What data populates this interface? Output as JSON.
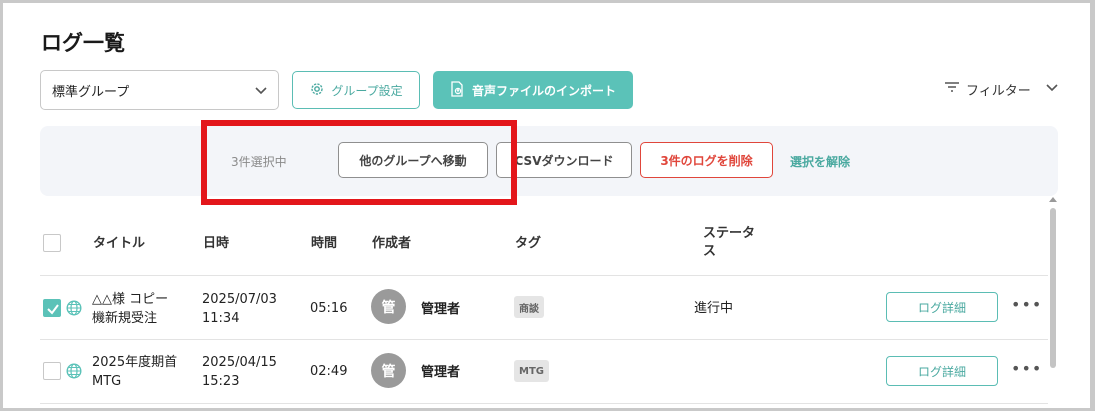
{
  "page": {
    "title": "ログ一覧"
  },
  "toolbar": {
    "group_select_value": "標準グループ",
    "group_settings_label": "グループ設定",
    "import_label": "音声ファイルのインポート",
    "filter_label": "フィルター"
  },
  "selection_bar": {
    "count_text": "3件選択中",
    "move_label": "他のグループへ移動",
    "csv_label": "CSVダウンロード",
    "delete_label": "3件のログを削除",
    "clear_label": "選択を解除"
  },
  "table": {
    "headers": {
      "title": "タイトル",
      "datetime": "日時",
      "duration": "時間",
      "author": "作成者",
      "tag": "タグ",
      "status_line1": "ステータ",
      "status_line2": "ス"
    },
    "rows": [
      {
        "checked": true,
        "title_line1": "△△様 コピー",
        "title_line2": "機新規受注",
        "date": "2025/07/03",
        "time": "11:34",
        "duration": "05:16",
        "avatar": "管",
        "author": "管理者",
        "tag": "商談",
        "status": "進行中",
        "detail_label": "ログ詳細",
        "more": "•••"
      },
      {
        "checked": false,
        "title_line1": "2025年度期首",
        "title_line2": "MTG",
        "date": "2025/04/15",
        "time": "15:23",
        "duration": "02:49",
        "avatar": "管",
        "author": "管理者",
        "tag": "MTG",
        "status": "",
        "detail_label": "ログ詳細",
        "more": "•••"
      }
    ]
  },
  "colors": {
    "accent_teal": "#5bc2b8",
    "danger_red": "#e0463b",
    "highlight_red": "#e3161b"
  },
  "icons": [
    "chevron-down-icon",
    "gear-icon",
    "file-upload-icon",
    "filter-icon",
    "checkmark-icon",
    "globe-icon",
    "more-icon"
  ]
}
